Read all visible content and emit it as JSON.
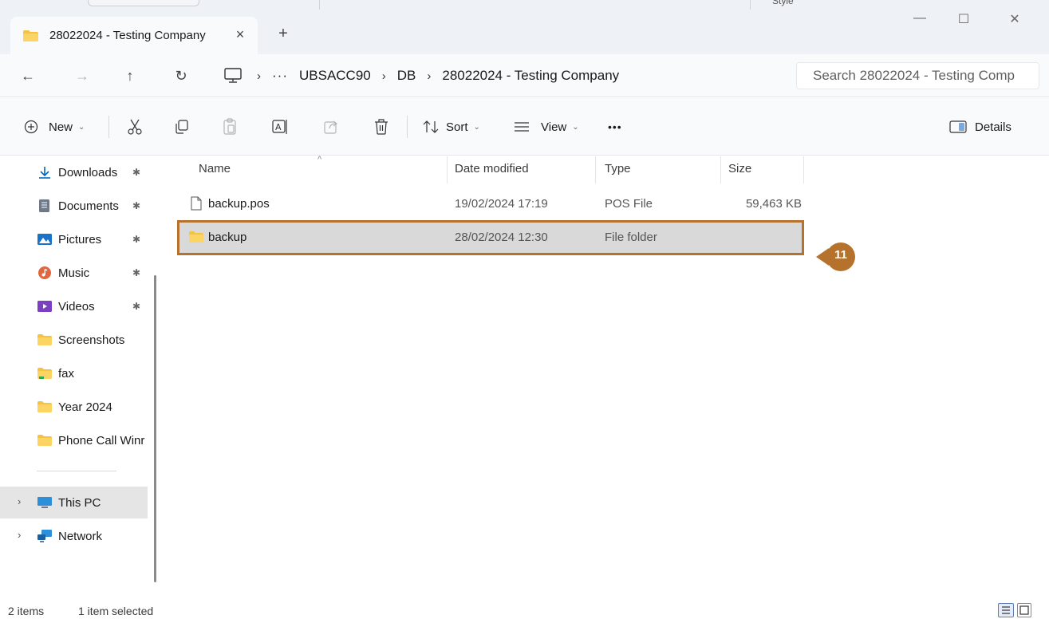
{
  "window": {
    "tab_title": "28022024 - Testing Company",
    "tab_close": "×",
    "new_tab": "+",
    "minimize": "—",
    "maximize": "☐",
    "close": "✕",
    "partial_text": "Style"
  },
  "nav": {
    "back": "←",
    "forward": "→",
    "up": "↑",
    "refresh": "↻",
    "breadcrumb_sep": "›",
    "more": "···",
    "breadcrumbs": [
      "UBSACC90",
      "DB",
      "28022024 - Testing Company"
    ],
    "search_placeholder": "Search 28022024 - Testing Comp"
  },
  "commands": {
    "new_label": "New",
    "sort_label": "Sort",
    "view_label": "View",
    "more": "•••",
    "details_label": "Details",
    "chevron": "⌄"
  },
  "sidebar": {
    "items": [
      {
        "label": "Downloads",
        "icon": "download-icon",
        "pinned": true
      },
      {
        "label": "Documents",
        "icon": "documents-icon",
        "pinned": true
      },
      {
        "label": "Pictures",
        "icon": "pictures-icon",
        "pinned": true
      },
      {
        "label": "Music",
        "icon": "music-icon",
        "pinned": true
      },
      {
        "label": "Videos",
        "icon": "videos-icon",
        "pinned": true
      },
      {
        "label": "Screenshots",
        "icon": "folder-icon",
        "pinned": false
      },
      {
        "label": "fax",
        "icon": "folder-icon",
        "pinned": false
      },
      {
        "label": "Year 2024",
        "icon": "folder-icon",
        "pinned": false
      },
      {
        "label": "Phone Call Winr",
        "icon": "folder-icon",
        "pinned": false
      }
    ],
    "this_pc": "This PC",
    "network": "Network",
    "expander": "›",
    "pin": "✱"
  },
  "columns": {
    "name": "Name",
    "date": "Date modified",
    "type": "Type",
    "size": "Size",
    "sort_caret": "^"
  },
  "files": [
    {
      "name": "backup.pos",
      "date": "19/02/2024 17:19",
      "type": "POS File",
      "size": "59,463 KB",
      "icon": "file-icon",
      "selected": false
    },
    {
      "name": "backup",
      "date": "28/02/2024 12:30",
      "type": "File folder",
      "size": "",
      "icon": "folder-icon",
      "selected": true
    }
  ],
  "annotation": {
    "number": "11",
    "color": "#b5722d"
  },
  "status": {
    "item_count": "2 items",
    "selected": "1 item selected"
  },
  "colors": {
    "folder": "#f5c242",
    "accent": "#0067c0",
    "highlight_border": "#b5722d"
  }
}
